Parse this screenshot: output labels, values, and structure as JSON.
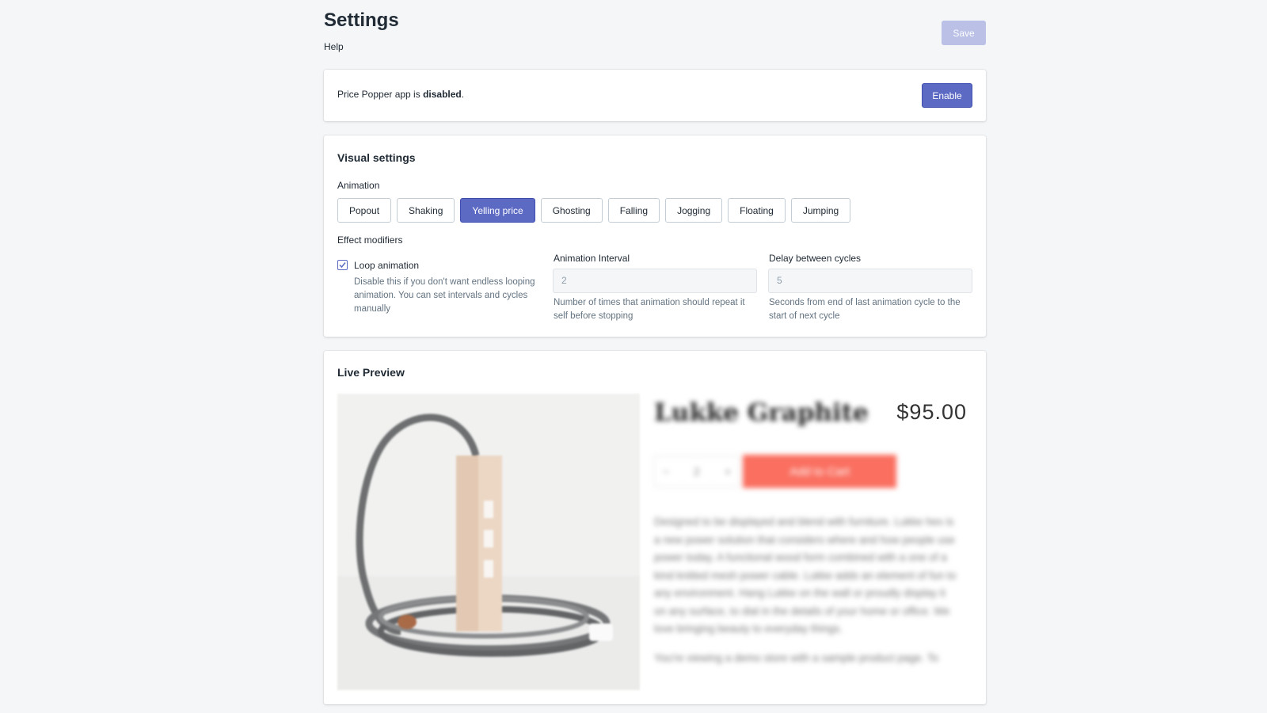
{
  "header": {
    "title": "Settings",
    "help": "Help",
    "save_label": "Save"
  },
  "status": {
    "prefix": "Price Popper app is ",
    "state": "disabled",
    "suffix": ".",
    "enable_label": "Enable"
  },
  "visual": {
    "title": "Visual settings",
    "animation_label": "Animation",
    "animations": [
      "Popout",
      "Shaking",
      "Yelling price",
      "Ghosting",
      "Falling",
      "Jogging",
      "Floating",
      "Jumping"
    ],
    "selected_animation": "Yelling price",
    "effect_label": "Effect modifiers",
    "loop": {
      "label": "Loop animation",
      "checked": true,
      "help": "Disable this if you don't want endless looping animation. You can set intervals and cycles manually"
    },
    "interval": {
      "label": "Animation Interval",
      "value": "2",
      "help": "Number of times that animation should repeat it self before stopping"
    },
    "delay": {
      "label": "Delay between cycles",
      "value": "5",
      "help": "Seconds from end of last animation cycle to the start of next cycle"
    }
  },
  "preview": {
    "title": "Live Preview",
    "product_name": "Lukke Graphite",
    "price": "$95.00",
    "qty_minus": "−",
    "qty_value": "2",
    "qty_plus": "+",
    "add_to_cart": "Add to Cart",
    "description_1": "Designed to be displayed and blend with furniture. Lukke hex is a new power solution that considers where and how people use power today. A functional wood form combined with a one of a kind knitted mesh power cable. Lukke adds an element of fun to any environment. Hang Lukke on the wall or proudly display it on any surface, to dial in the details of your home or office. We love bringing beauty to everyday things.",
    "description_2": "You're viewing a demo store with a sample product page. To"
  },
  "colors": {
    "primary": "#5c6ac4",
    "cart": "#fa6f60",
    "background": "#f4f6f8"
  }
}
